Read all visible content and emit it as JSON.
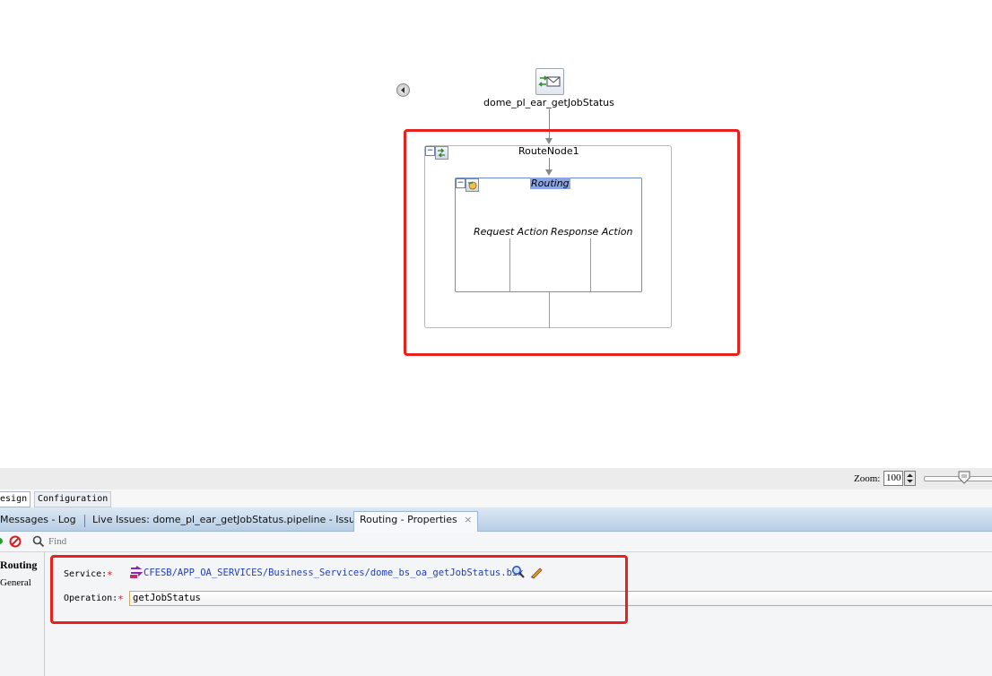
{
  "diagram": {
    "proxy_service_label": "dome_pl_ear_getJobStatus",
    "route_node_label": "RouteNode1",
    "routing_label": "Routing",
    "request_action_label": "Request Action",
    "response_action_label": "Response Action"
  },
  "zoom": {
    "label": "Zoom:",
    "value": "100"
  },
  "view_tabs": [
    "Design",
    "Configuration"
  ],
  "panel_tabs": {
    "messages_log": "Messages - Log",
    "live_issues": "Live Issues: dome_pl_ear_getJobStatus.pipeline - Issues",
    "routing_properties": "Routing - Properties",
    "close_glyph": "×"
  },
  "find": {
    "placeholder": "Find"
  },
  "left_nav": {
    "routing": "Routing",
    "general": "General"
  },
  "properties": {
    "service_label": "Service:",
    "service_required": "*",
    "service_value": "CFESB/APP_OA_SERVICES/Business_Services/dome_bs_oa_getJobStatus.bix",
    "operation_label": "Operation:",
    "operation_required": "*",
    "operation_value": "getJobStatus"
  },
  "colors": {
    "highlight_frame": "#e8211d",
    "routing_selected_bg": "#8aa6e6",
    "link_text": "#1f3fbf",
    "required_star": "#d0201d"
  },
  "icons": [
    "back-arrow-icon",
    "proxy-service-icon",
    "collapse-icon",
    "route-node-icon",
    "routing-icon",
    "run-icon",
    "stop-icon",
    "search-icon",
    "service-type-icon",
    "browse-icon",
    "edit-pencil-icon",
    "spinner-up-icon",
    "spinner-down-icon",
    "zoom-slider-thumb-icon"
  ]
}
